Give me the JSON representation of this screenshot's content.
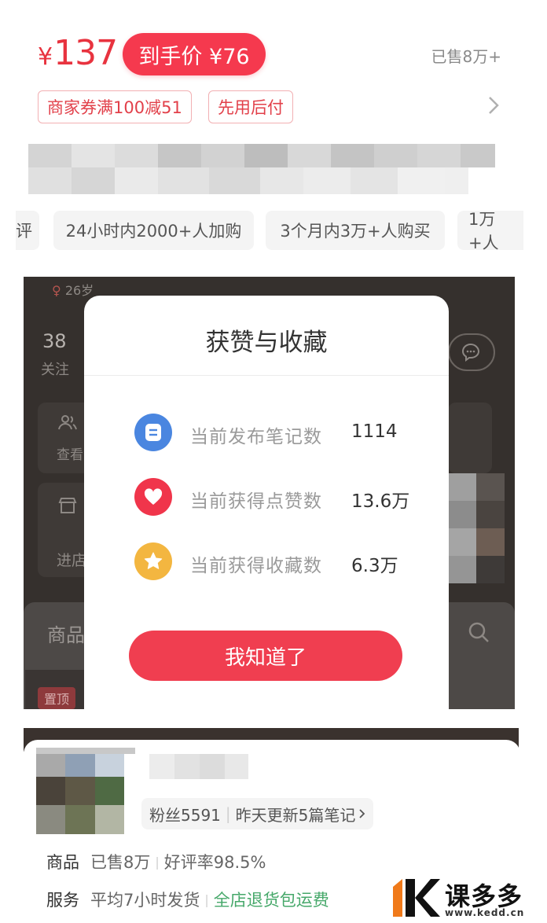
{
  "product": {
    "price_symbol": "¥",
    "price": "137",
    "final_price_label": "到手价 ¥76",
    "sold": "已售8万+",
    "tags": [
      "商家券满100减51",
      "先用后付"
    ]
  },
  "chips": [
    "评",
    "24小时内2000+人加购",
    "3个月内3万+人购买",
    "1万+人"
  ],
  "background_profile": {
    "age_badge": "26岁",
    "follow_count": "38",
    "follow_label": "关注",
    "view_label": "查看",
    "enter_label": "进店",
    "goods_label": "商品",
    "pin_label": "置顶"
  },
  "modal": {
    "title": "获赞与收藏",
    "stats": [
      {
        "icon": "note-icon",
        "label": "当前发布笔记数",
        "value": "1114",
        "color": "#4a86e0"
      },
      {
        "icon": "heart-icon",
        "label": "当前获得点赞数",
        "value": "13.6万",
        "color": "#f0354b"
      },
      {
        "icon": "star-icon",
        "label": "当前获得收藏数",
        "value": "6.3万",
        "color": "#f3b640"
      }
    ],
    "ok_button": "我知道了"
  },
  "store": {
    "fans": "粉丝5591",
    "update": "昨天更新5篇笔记",
    "goods_label": "商品",
    "goods_sold": "已售8万",
    "goods_rating": "好评率98.5%",
    "service_label": "服务",
    "service_ship": "平均7小时发货",
    "service_policy": "全店退货包运费"
  },
  "watermark": {
    "name": "课多多",
    "url": "www.kedd.cn"
  },
  "colors": {
    "accent": "#f03e50",
    "price_red": "#e8333f",
    "green": "#46a86a"
  }
}
